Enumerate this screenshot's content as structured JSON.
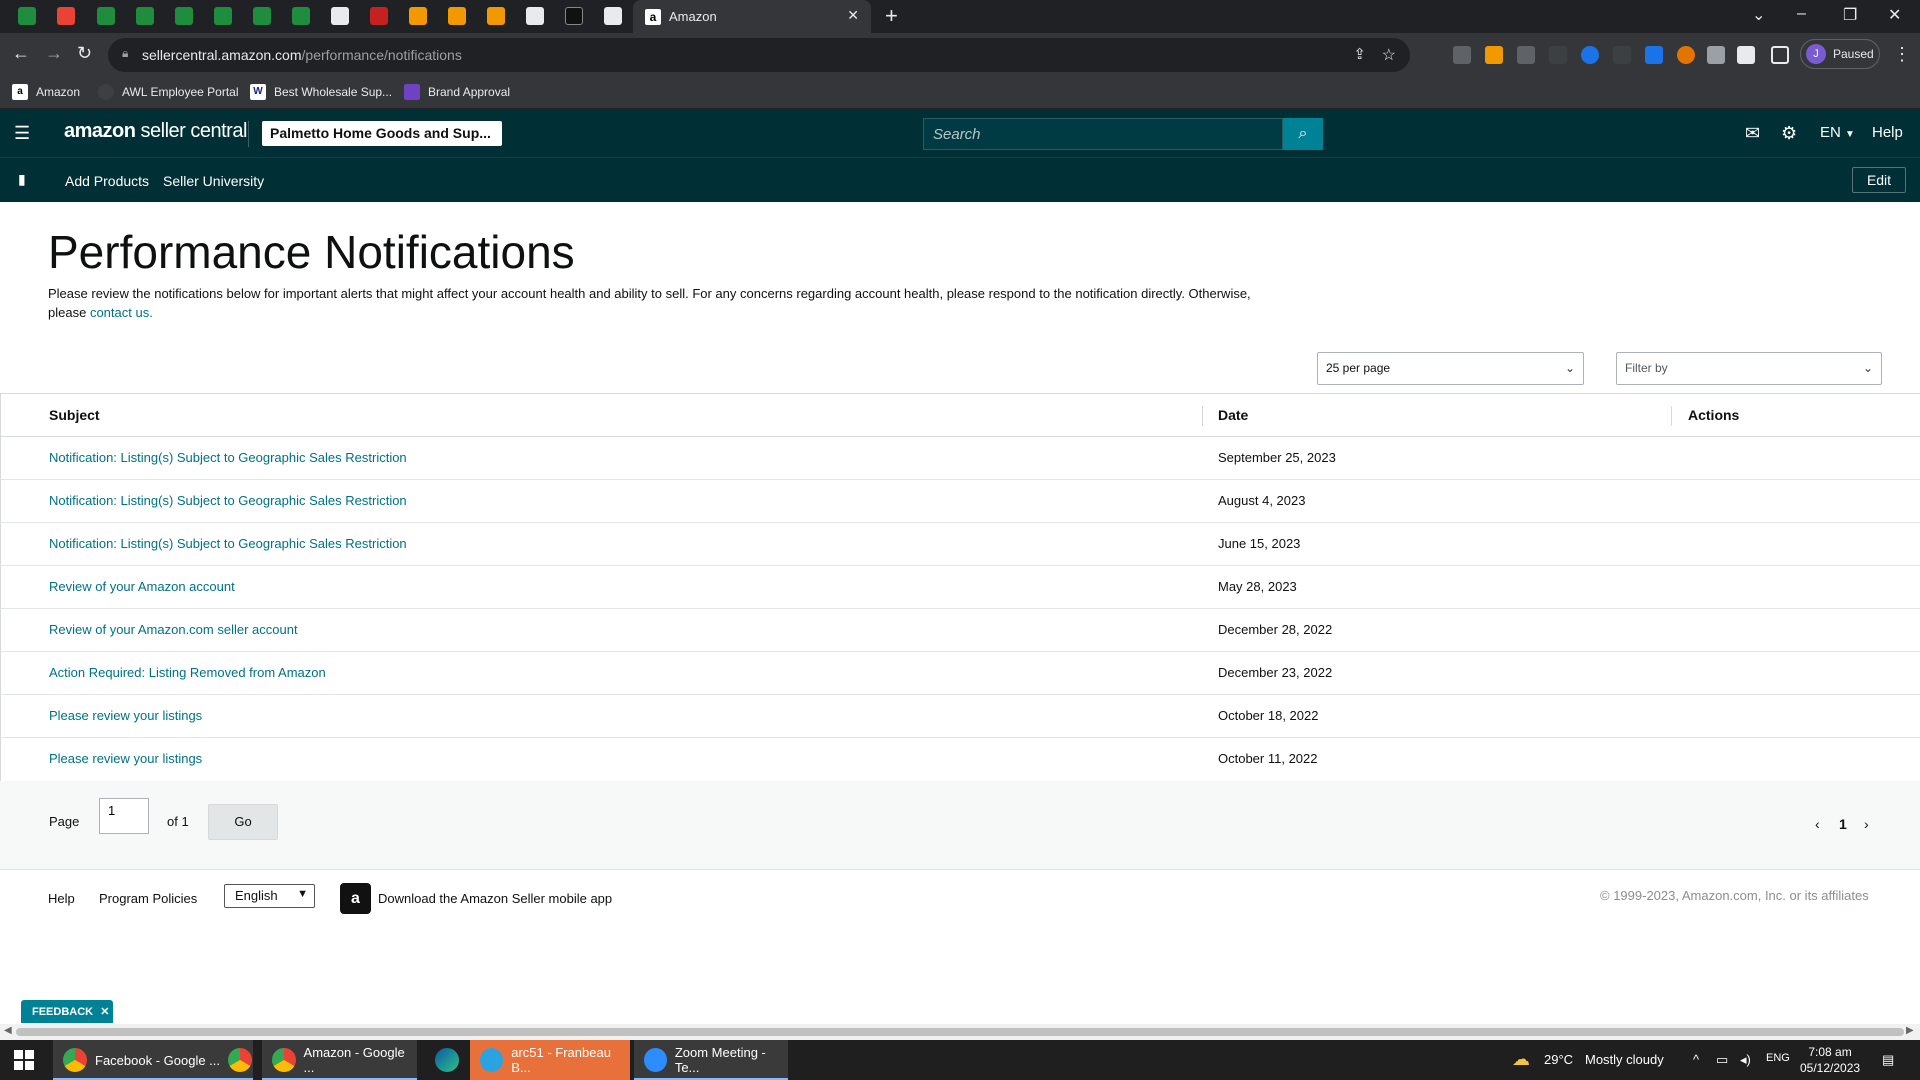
{
  "browser": {
    "active_tab_title": "Amazon",
    "url_domain": "sellercentral.amazon.com",
    "url_path": "/performance/notifications",
    "profile_initial": "J",
    "profile_status": "Paused",
    "bookmarks": [
      "Amazon",
      "AWL Employee Portal",
      "Best Wholesale Sup...",
      "Brand Approval"
    ]
  },
  "header": {
    "logo_brand": "amazon",
    "logo_product": "seller central",
    "store_name": "Palmetto Home Goods and Sup...",
    "search_placeholder": "Search",
    "language": "EN",
    "help": "Help"
  },
  "subnav": {
    "links": [
      "Add Products",
      "Seller University"
    ],
    "edit": "Edit"
  },
  "page": {
    "title": "Performance Notifications",
    "description": "Please review the notifications below for important alerts that might affect your account health and ability to sell. For any concerns regarding account health, please respond to the notification directly. Otherwise, please",
    "contact_link": "contact us.",
    "per_page": "25 per page",
    "filter_placeholder": "Filter by"
  },
  "table": {
    "columns": [
      "Subject",
      "Date",
      "Actions"
    ],
    "rows": [
      {
        "subject": "Notification: Listing(s) Subject to Geographic Sales Restriction",
        "date": "September 25, 2023"
      },
      {
        "subject": "Notification: Listing(s) Subject to Geographic Sales Restriction",
        "date": "August 4, 2023"
      },
      {
        "subject": "Notification: Listing(s) Subject to Geographic Sales Restriction",
        "date": "June 15, 2023"
      },
      {
        "subject": "Review of your Amazon account",
        "date": "May 28, 2023"
      },
      {
        "subject": "Review of your Amazon.com seller account",
        "date": "December 28, 2022"
      },
      {
        "subject": "Action Required: Listing Removed from Amazon",
        "date": "December 23, 2022"
      },
      {
        "subject": "Please review your listings",
        "date": "October 18, 2022"
      },
      {
        "subject": "Please review your listings",
        "date": "October 11, 2022"
      }
    ]
  },
  "pagination": {
    "page_label": "Page",
    "page_value": "1",
    "of_label": "of 1",
    "go": "Go",
    "current": "1"
  },
  "footer": {
    "help": "Help",
    "program_policies": "Program Policies",
    "language": "English",
    "app_text": "Download the Amazon Seller mobile app",
    "copyright": "© 1999-2023, Amazon.com, Inc. or its affiliates"
  },
  "feedback": "FEEDBACK",
  "taskbar": {
    "tasks": [
      "Facebook - Google ...",
      "Amazon - Google ...",
      "arc51 - Franbeau B...",
      "Zoom Meeting - Te..."
    ],
    "weather_temp": "29°C",
    "weather_desc": "Mostly cloudy",
    "input_lang": "ENG",
    "time": "7:08 am",
    "date": "05/12/2023"
  },
  "colors": {
    "header_bg": "#002f36",
    "link": "#007185",
    "search_btn": "#008296"
  }
}
